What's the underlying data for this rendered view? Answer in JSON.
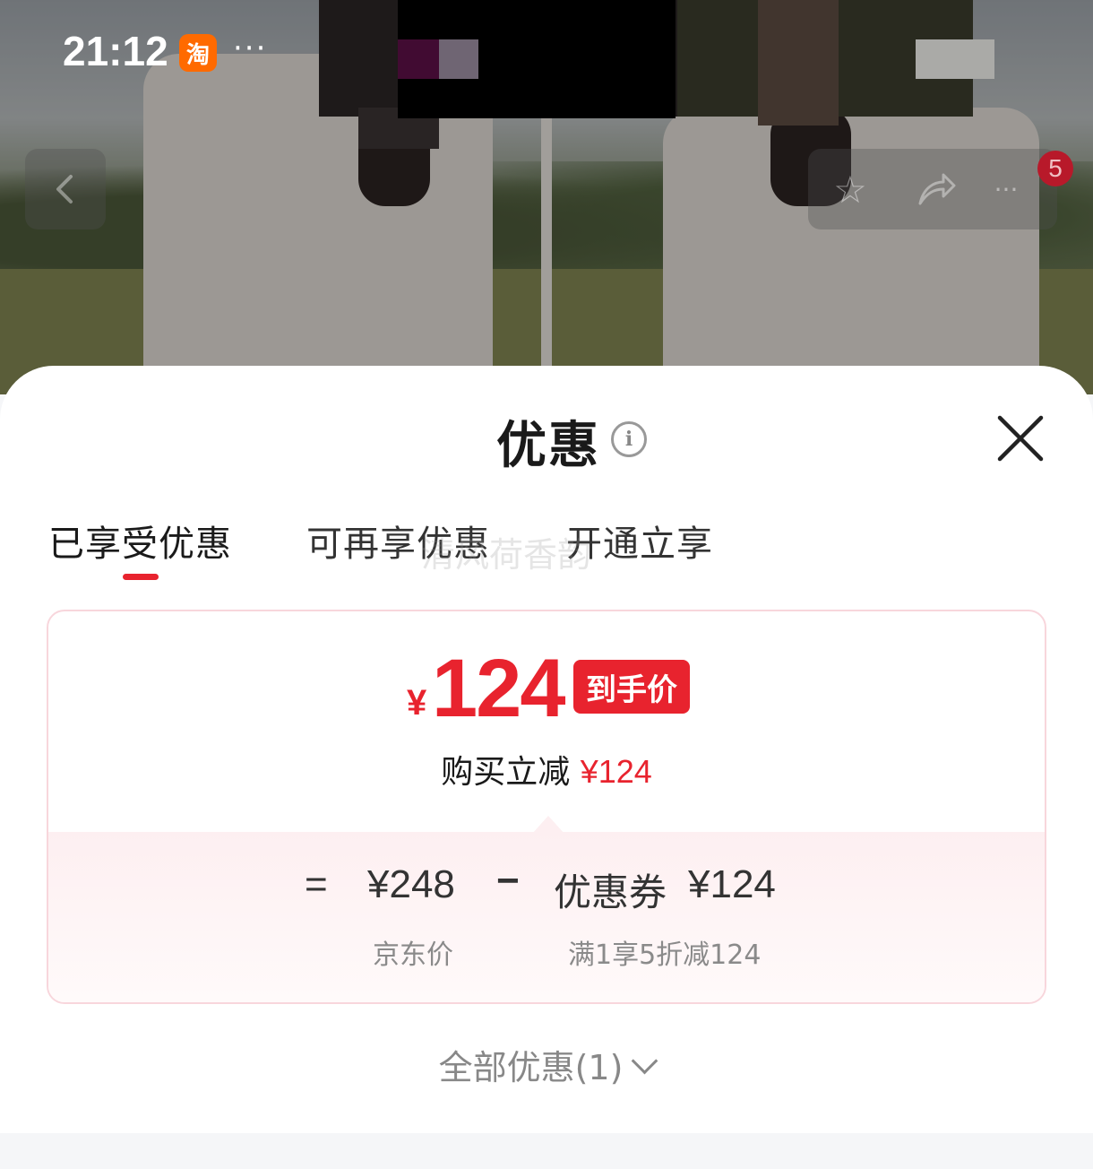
{
  "status_bar": {
    "time": "21:12",
    "app_icon_label": "淘",
    "more": "···"
  },
  "product_nav": {
    "back_icon": "chevron-left-icon",
    "favorite_icon": "star-icon",
    "share_icon": "share-icon",
    "more": "···",
    "badge_count": "5"
  },
  "sheet": {
    "title": "优惠",
    "info_icon": "i",
    "close_icon": "close-icon",
    "tabs": [
      {
        "label": "已享受优惠",
        "active": true
      },
      {
        "label": "可再享优惠",
        "active": false
      },
      {
        "label": "开通立享",
        "active": false
      }
    ],
    "watermark": "清风荷香韵",
    "final_price": {
      "currency": "¥",
      "amount": "124",
      "tag": "到手价"
    },
    "instant_reduction": {
      "label": "购买立减",
      "amount": "¥124"
    },
    "calculation": {
      "equals": "=",
      "base_price": "¥248",
      "minus": "−",
      "coupon": "优惠券",
      "coupon_amount": "¥124",
      "base_label": "京东价",
      "coupon_desc": "满1享5折减124"
    },
    "all_offers": "全部优惠(1)"
  },
  "colors": {
    "accent_red": "#e8232e",
    "card_border": "#f8d6dc"
  }
}
